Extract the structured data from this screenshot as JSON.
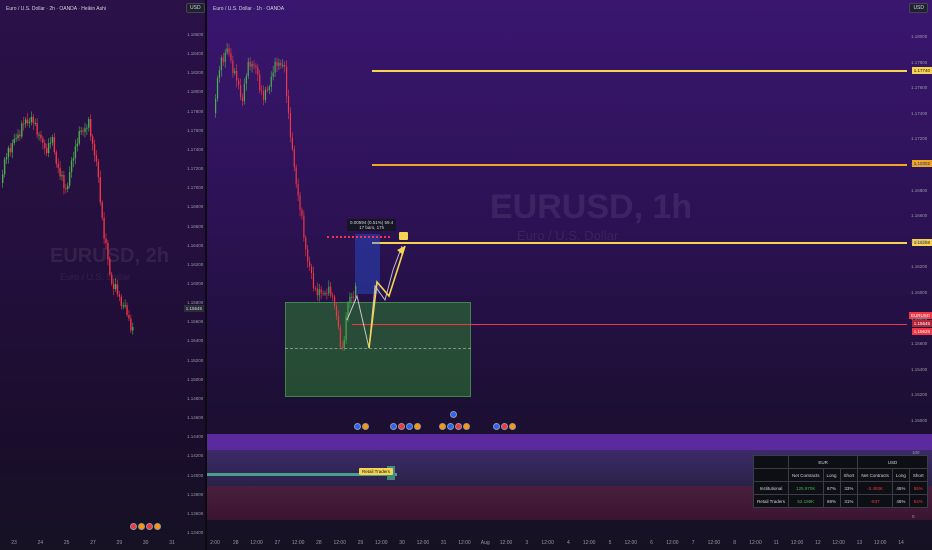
{
  "left_pane": {
    "legend": "Euro / U.S. Dollar · 2h · OANDA · Heikin Ashi",
    "currency": "USD",
    "watermark_symbol": "EURUSD, 2h",
    "watermark_name": "Euro / U.S. Dollar",
    "price_axis": [
      "1.18600",
      "1.18400",
      "1.18200",
      "1.18000",
      "1.17800",
      "1.17600",
      "1.17400",
      "1.17200",
      "1.17000",
      "1.16800",
      "1.16600",
      "1.16400",
      "1.16200",
      "1.16000",
      "1.15800",
      "1.15600",
      "1.15400",
      "1.15200",
      "1.15000",
      "1.14800",
      "1.14600",
      "1.14400",
      "1.14200",
      "1.14000",
      "1.13800",
      "1.13600",
      "1.13400"
    ],
    "last_price": "1.15645",
    "x_axis": [
      "23",
      "24",
      "25",
      "27",
      "29",
      "30",
      "31"
    ]
  },
  "right_pane": {
    "legend": "Euro / U.S. Dollar · 1h · OANDA",
    "currency": "USD",
    "watermark_symbol": "EURUSD, 1h",
    "watermark_name": "Euro / U.S. Dollar",
    "price_axis": [
      "1.18000",
      "1.17800",
      "1.17600",
      "1.17400",
      "1.17200",
      "1.17000",
      "1.16800",
      "1.16600",
      "1.16400",
      "1.16200",
      "1.16000",
      "1.15800",
      "1.15600",
      "1.15400",
      "1.15200",
      "1.15000"
    ],
    "levels": {
      "top": "1.17740",
      "mid": "1.16882",
      "target": "1.16288",
      "eurusd_label": "EURUSD",
      "current": "1.15645",
      "red": "1.15629"
    },
    "measure_line1": "0.00594 (0.51%) 59.4",
    "measure_line2": "17 bars, 17h",
    "retail_tag": "Retail Traders",
    "indicator_axis": [
      "100",
      "75",
      "50",
      "25",
      "0"
    ],
    "x_axis": [
      "2:00",
      "28",
      "12:00",
      "27",
      "12:00",
      "28",
      "12:00",
      "29",
      "12:00",
      "30",
      "12:00",
      "31",
      "12:00",
      "Aug",
      "12:00",
      "3",
      "12:00",
      "4",
      "12:00",
      "5",
      "12:00",
      "6",
      "12:00",
      "7",
      "12:00",
      "8",
      "12:00",
      "11",
      "12:00",
      "12",
      "12:00",
      "13",
      "12:00",
      "14"
    ]
  },
  "cot_table": {
    "headers": {
      "eur": "EUR",
      "usd": "USD"
    },
    "subheaders": [
      "Net Contracts",
      "Long",
      "Short",
      "Net Contracts",
      "Long",
      "Short"
    ],
    "rows": [
      {
        "label": "Institutional",
        "cells": [
          "125.970K",
          "67%",
          "33%",
          "-3.493K",
          "45%",
          "55%"
        ]
      },
      {
        "label": "Retail Traders",
        "cells": [
          "52.198K",
          "69%",
          "31%",
          "-937",
          "46%",
          "54%"
        ]
      }
    ]
  },
  "colors": {
    "level_yellow": "#f7d352",
    "level_orange": "#f5a524",
    "level_red": "#f23645",
    "zone_green": "#2e7d32",
    "candle_up": "#4caf50",
    "candle_down": "#f23645"
  }
}
